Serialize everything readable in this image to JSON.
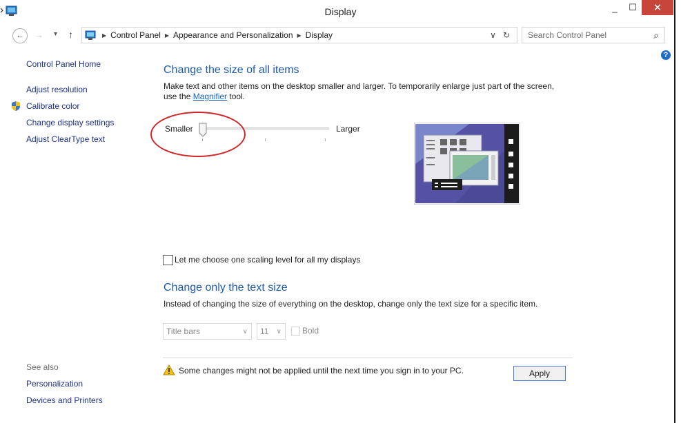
{
  "window": {
    "title": "Display",
    "minimize": "_",
    "maximize": "☐",
    "close": "✕"
  },
  "nav": {
    "back": "←",
    "forward": "→",
    "recent": "▾",
    "up": "↑",
    "breadcrumbs": [
      "Control Panel",
      "Appearance and Personalization",
      "Display"
    ],
    "dropdown": "∨",
    "refresh": "↻",
    "search_placeholder": "Search Control Panel",
    "search_icon": "⌕",
    "help": "?"
  },
  "sidebar": {
    "home": "Control Panel Home",
    "items": [
      {
        "label": "Adjust resolution"
      },
      {
        "label": "Calibrate color",
        "icon": "shield-icon"
      },
      {
        "label": "Change display settings"
      },
      {
        "label": "Adjust ClearType text"
      }
    ],
    "see_also": "See also",
    "see_also_items": [
      "Personalization",
      "Devices and Printers"
    ]
  },
  "main": {
    "size_heading": "Change the size of all items",
    "size_desc_1": "Make text and other items on the desktop smaller and larger. To temporarily enlarge just part of the screen,",
    "size_desc_2a": "use the ",
    "magnifier_link": "Magnifier",
    "size_desc_2b": " tool.",
    "slider": {
      "min_label": "Smaller",
      "max_label": "Larger",
      "value": 0.0
    },
    "checkbox_label": "Let me choose one scaling level for all my displays",
    "text_heading": "Change only the text size",
    "text_desc": "Instead of changing the size of everything on the desktop, change only the text size for a specific item.",
    "item_select": "Title bars",
    "size_select": "11",
    "bold_label": "Bold",
    "warning": "Some changes might not be applied until the next time you sign in to your PC.",
    "apply": "Apply"
  },
  "colors": {
    "heading": "#1e5ba8",
    "link": "#1e3287",
    "close": "#c7453b",
    "annotation": "#d0282a"
  }
}
